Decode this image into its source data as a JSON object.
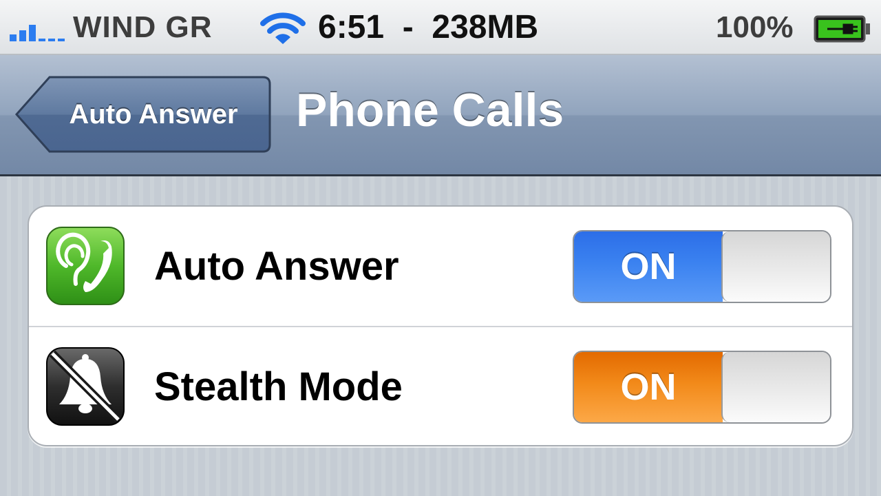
{
  "status_bar": {
    "carrier": "WIND GR",
    "time": "6:51  -  238MB",
    "battery_percent": "100%",
    "icons": {
      "signal": "signal-bars-icon",
      "wifi": "wifi-icon",
      "battery": "battery-charging-icon"
    },
    "colors": {
      "signal": "#2b7cf0",
      "wifi": "#1f6fe8",
      "battery_fill": "#39c21d"
    }
  },
  "nav_bar": {
    "back_label": "Auto Answer",
    "title": "Phone Calls"
  },
  "settings": {
    "rows": [
      {
        "label": "Auto Answer",
        "toggle_label": "ON",
        "state": "on",
        "icon": "phone-ear-icon",
        "accent": "#3b82f0"
      },
      {
        "label": "Stealth Mode",
        "toggle_label": "ON",
        "state": "on",
        "icon": "muted-bell-icon",
        "accent": "#f28a1a"
      }
    ]
  }
}
